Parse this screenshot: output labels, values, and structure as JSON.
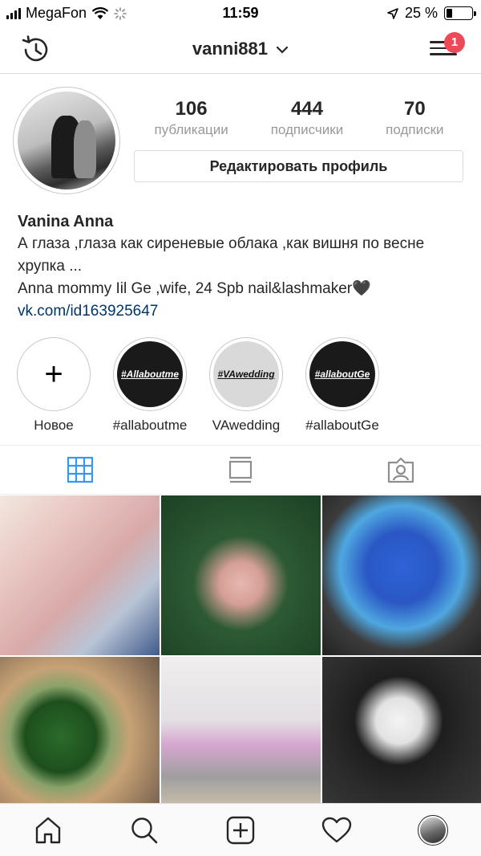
{
  "status_bar": {
    "carrier": "MegaFon",
    "time": "11:59",
    "battery_text": "25 %",
    "battery_level": 0.25
  },
  "header": {
    "username": "vanni881",
    "notification_count": "1"
  },
  "profile": {
    "stats": [
      {
        "value": "106",
        "label": "публикации"
      },
      {
        "value": "444",
        "label": "подписчики"
      },
      {
        "value": "70",
        "label": "подписки"
      }
    ],
    "edit_button": "Редактировать профиль",
    "name": "Vanina Anna",
    "bio_line1": "А глаза ,глаза как сиреневые облака ,как вишня по весне хрупка ...",
    "bio_line2": "Anna mommy Iil Ge ,wife, 24 Spb nail&lashmaker🖤",
    "link": "vk.com/id163925647"
  },
  "highlights": [
    {
      "caption": "Новое",
      "cover_text": "+",
      "style": "plus"
    },
    {
      "caption": "#allaboutme",
      "cover_text": "#Allaboutme",
      "style": "dark"
    },
    {
      "caption": "VAwedding",
      "cover_text": "#VAwedding",
      "style": "light"
    },
    {
      "caption": "#allaboutGe",
      "cover_text": "#allaboutGe",
      "style": "dark"
    }
  ],
  "tabs": [
    "grid-icon",
    "feed-icon",
    "tagged-icon"
  ],
  "nav": [
    "home-icon",
    "search-icon",
    "add-post-icon",
    "activity-icon",
    "profile-icon"
  ],
  "colors": {
    "accent_blue": "#3897f0",
    "link_blue": "#003569",
    "badge_red": "#ed4956"
  }
}
